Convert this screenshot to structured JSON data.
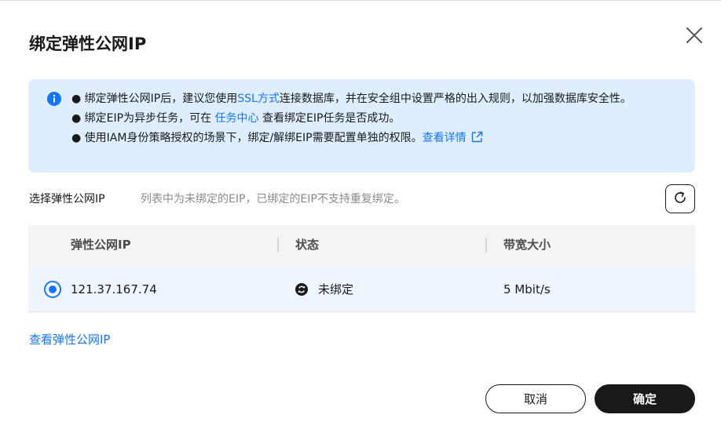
{
  "dialog": {
    "title": "绑定弹性公网IP"
  },
  "notice": {
    "line1_prefix": "● 绑定弹性公网IP后，建议您使用",
    "line1_link": "SSL方式",
    "line1_suffix": "连接数据库，并在安全组中设置严格的出入规则，以加强数据库安全性。",
    "line2_prefix": "● 绑定EIP为异步任务，可在 ",
    "line2_link": "任务中心",
    "line2_suffix": " 查看绑定EIP任务是否成功。",
    "line3_prefix": "● 使用IAM身份策略授权的场景下，绑定/解绑EIP需要配置单独的权限。",
    "line3_link": "查看详情"
  },
  "selection": {
    "label": "选择弹性公网IP",
    "hint": "列表中为未绑定的EIP，已绑定的EIP不支持重复绑定。"
  },
  "table": {
    "columns": [
      "弹性公网IP",
      "状态",
      "带宽大小"
    ],
    "rows": [
      {
        "selected": true,
        "ip": "121.37.167.74",
        "status": "未绑定",
        "bandwidth": "5 Mbit/s"
      }
    ]
  },
  "footer": {
    "view_link": "查看弹性公网IP",
    "cancel_label": "取消",
    "ok_label": "确定"
  },
  "colors": {
    "accent": "#1476ff",
    "notice_bg": "#dfeeff",
    "primary_button": "#191919",
    "selected_row": "#eef5ff"
  },
  "icons": [
    "close-icon",
    "info-icon",
    "external-link-icon",
    "refresh-icon",
    "status-unbound-icon"
  ]
}
